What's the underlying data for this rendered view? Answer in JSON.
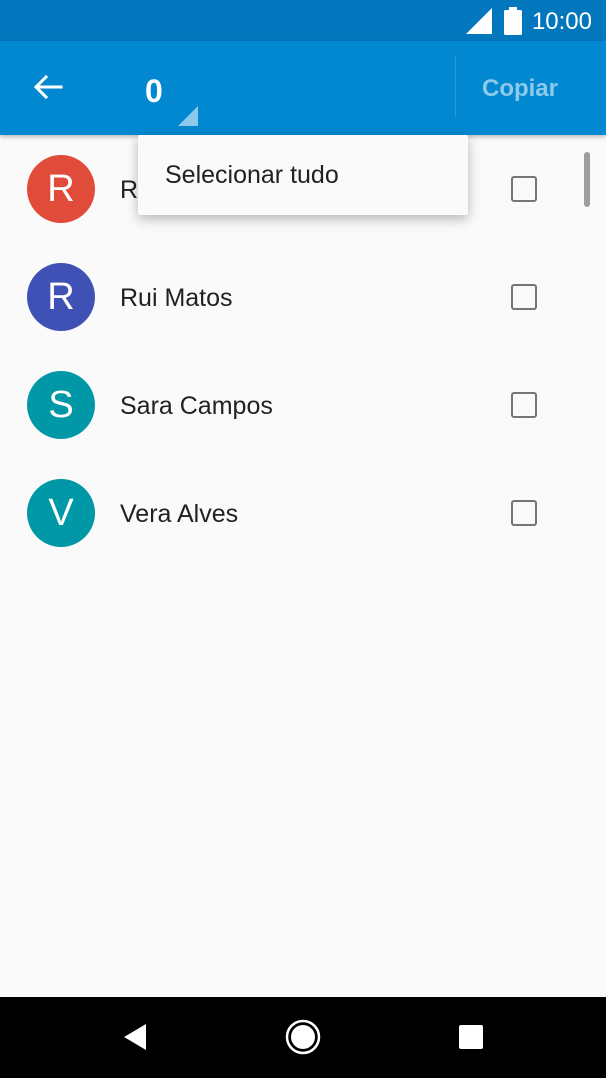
{
  "status_bar": {
    "time": "10:00"
  },
  "app_bar": {
    "selected_count": "0",
    "copy_label": "Copiar"
  },
  "menu": {
    "items": [
      {
        "label": "Selecionar tudo"
      }
    ]
  },
  "contacts": [
    {
      "initial": "R",
      "name": "R",
      "color": "#e04b3a",
      "checked": false
    },
    {
      "initial": "R",
      "name": "Rui Matos",
      "color": "#3f51b5",
      "checked": false
    },
    {
      "initial": "S",
      "name": "Sara Campos",
      "color": "#0097a7",
      "checked": false
    },
    {
      "initial": "V",
      "name": "Vera Alves",
      "color": "#0097a7",
      "checked": false
    }
  ],
  "colors": {
    "status_bar": "#0277bd",
    "app_bar": "#0288d1",
    "background": "#fafafa"
  },
  "icons": {
    "back": "arrow-left-icon",
    "signal": "signal-icon",
    "battery": "battery-icon",
    "nav_back": "triangle-back-icon",
    "nav_home": "circle-home-icon",
    "nav_recents": "square-recents-icon"
  }
}
